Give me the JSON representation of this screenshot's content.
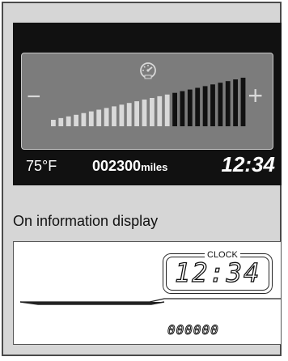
{
  "dashboard": {
    "temperature": "75",
    "temperature_unit": "°F",
    "odometer": "002300",
    "odometer_unit": "miles",
    "clock": "12:34",
    "minus_symbol": "−",
    "plus_symbol": "+",
    "icon": "speedometer-icon",
    "segment_count": 26,
    "segments_lit": 16
  },
  "section_label": "On information display",
  "info_display": {
    "clock_label": "CLOCK",
    "clock": "12:34",
    "odometer": "000000"
  },
  "colors": {
    "panel_background": "#111111",
    "gauge_background": "#7c7c7c",
    "bar_lit": "#d9d9d9",
    "bar_dim": "#111111"
  }
}
